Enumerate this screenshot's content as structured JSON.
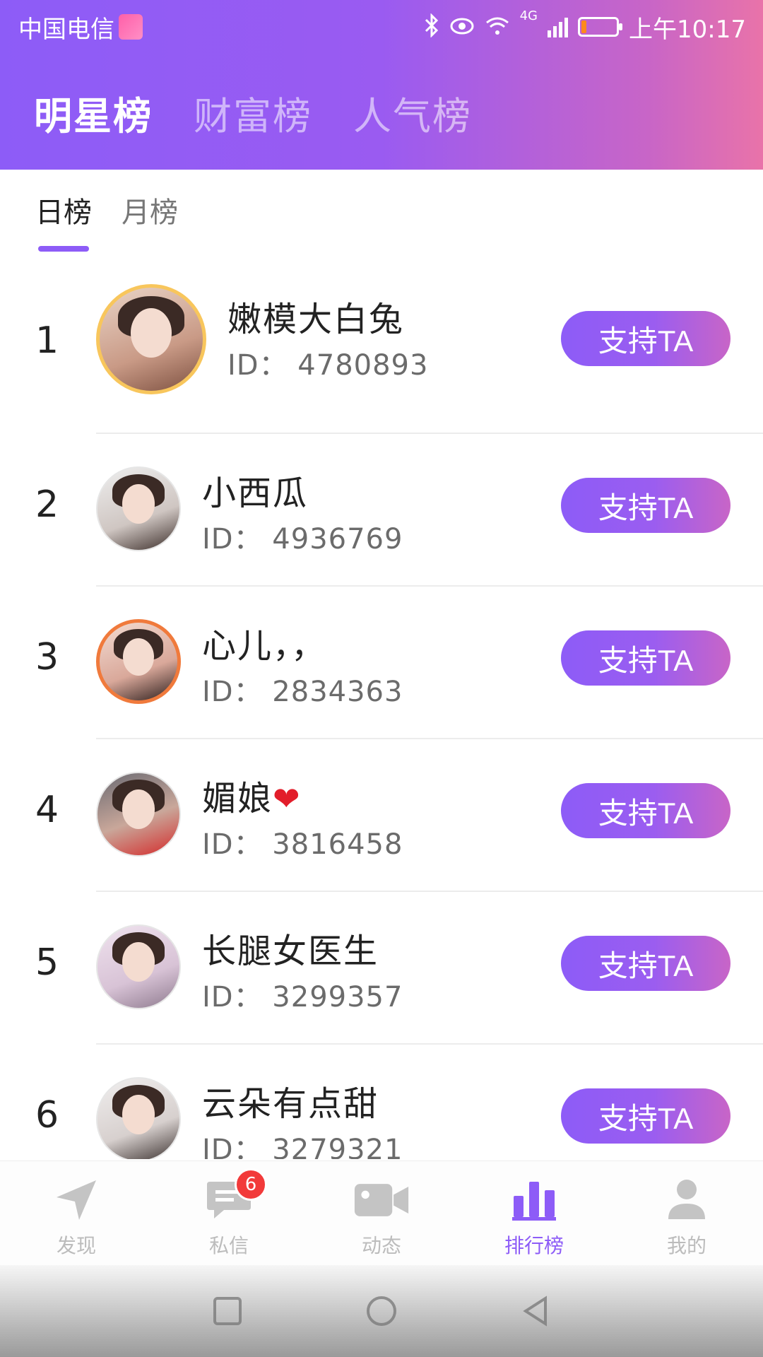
{
  "status_bar": {
    "carrier": "中国电信",
    "time": "上午10:17",
    "network": "4G",
    "battery_level": 0.15,
    "icons": [
      "bluetooth-icon",
      "eye-icon",
      "wifi-icon",
      "signal-icon",
      "battery-icon"
    ]
  },
  "main_tabs": [
    {
      "label": "明星榜",
      "active": true
    },
    {
      "label": "财富榜",
      "active": false
    },
    {
      "label": "人气榜",
      "active": false
    }
  ],
  "sub_tabs": [
    {
      "label": "日榜",
      "active": true
    },
    {
      "label": "月榜",
      "active": false
    }
  ],
  "ranking": [
    {
      "rank": "1",
      "name": "嫩模大白兔",
      "id": "ID： 4780893",
      "button": "支持TA"
    },
    {
      "rank": "2",
      "name": "小西瓜",
      "id": "ID： 4936769",
      "button": "支持TA"
    },
    {
      "rank": "3",
      "name": "心儿，，",
      "id": "ID： 2834363",
      "button": "支持TA"
    },
    {
      "rank": "4",
      "name": "媚娘",
      "name_suffix": "❤",
      "id": "ID： 3816458",
      "button": "支持TA"
    },
    {
      "rank": "5",
      "name": "长腿女医生",
      "id": "ID： 3299357",
      "button": "支持TA"
    },
    {
      "rank": "6",
      "name": "云朵有点甜",
      "id": "ID： 3279321",
      "button": "支持TA"
    }
  ],
  "bottom_nav": [
    {
      "label": "发现",
      "icon": "navigation-arrow-icon",
      "active": false
    },
    {
      "label": "私信",
      "icon": "chat-bubble-icon",
      "active": false,
      "badge": "6"
    },
    {
      "label": "动态",
      "icon": "video-camera-icon",
      "active": false
    },
    {
      "label": "排行榜",
      "icon": "bar-chart-icon",
      "active": true
    },
    {
      "label": "我的",
      "icon": "person-icon",
      "active": false
    }
  ],
  "colors": {
    "accent": "#8d5cf7",
    "gradient_end": "#e973a9",
    "gold_ring": "#f8c65c",
    "bronze_ring": "#f07a3c",
    "badge_red": "#f23a3a"
  }
}
